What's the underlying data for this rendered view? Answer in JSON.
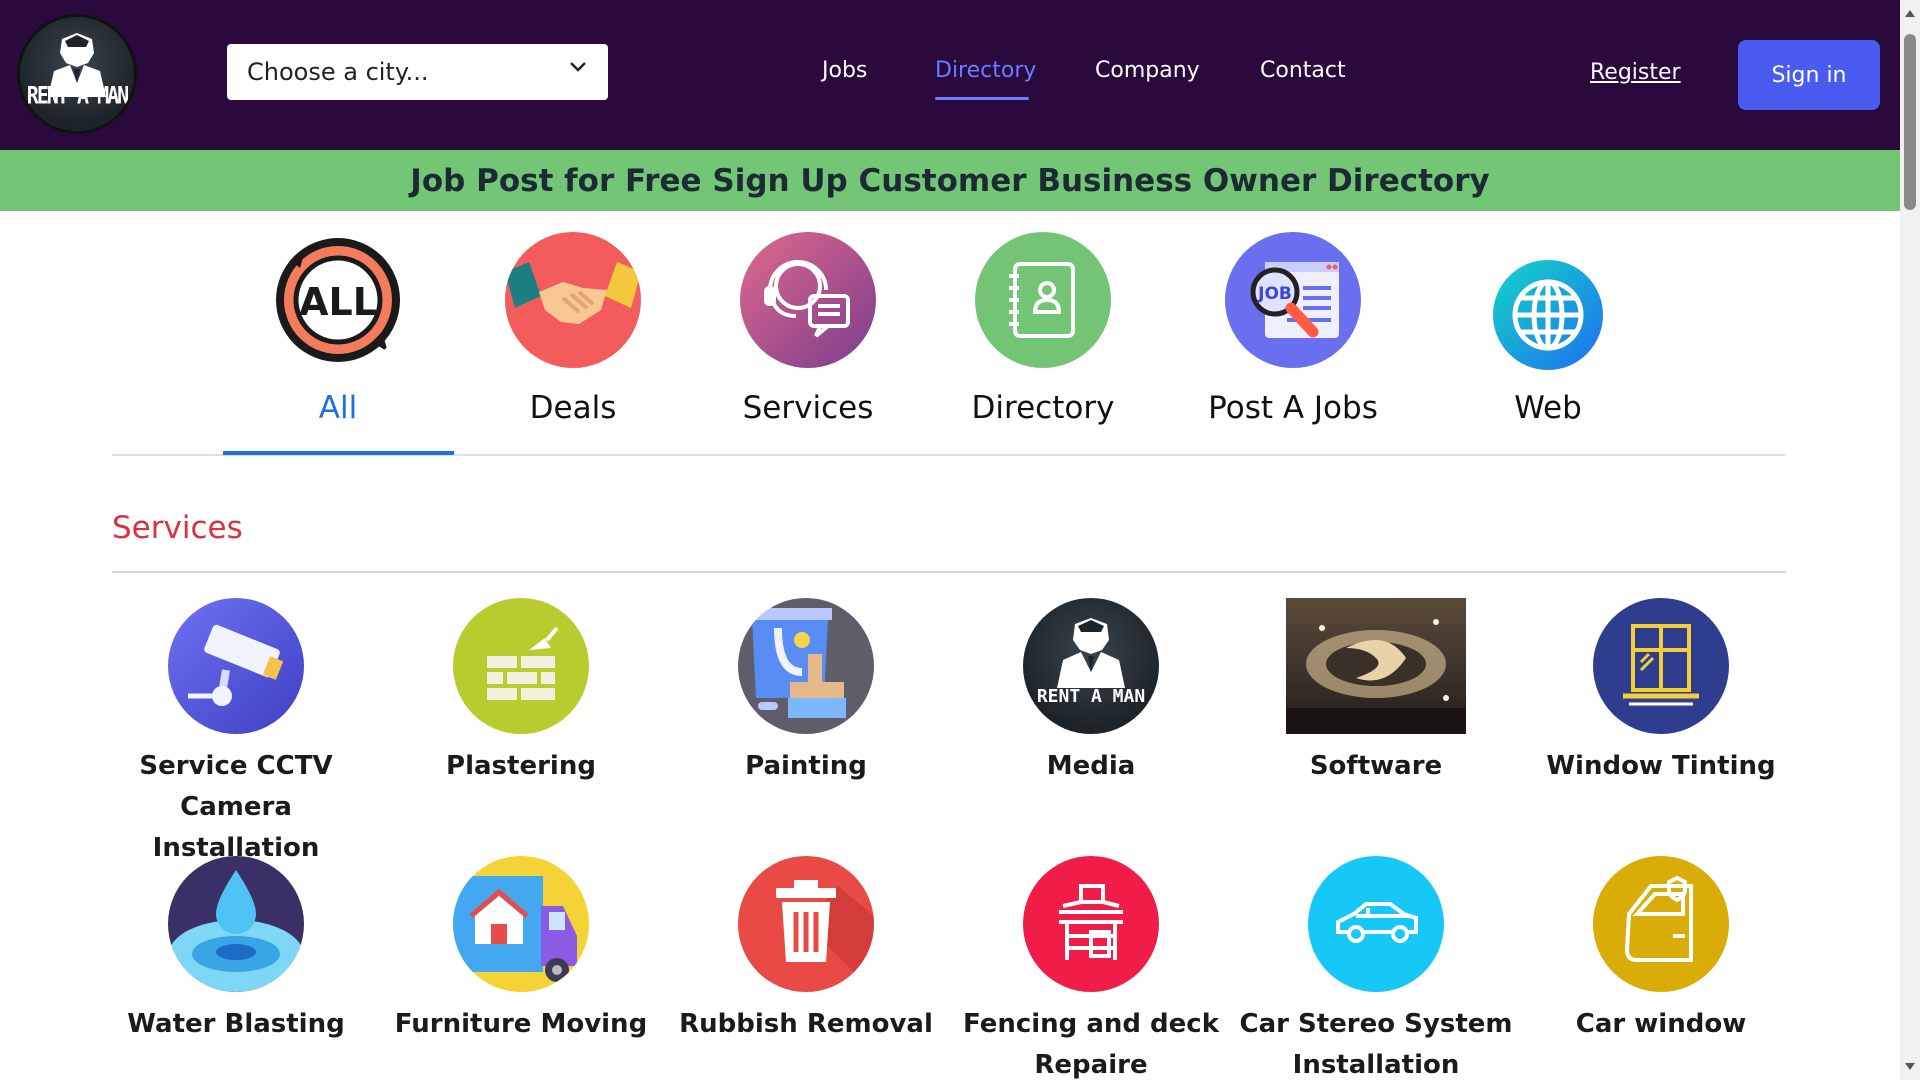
{
  "header": {
    "logo_text": "RENT A MAN",
    "city_placeholder": "Choose a city...",
    "nav": [
      {
        "label": "Jobs",
        "active": false
      },
      {
        "label": "Directory",
        "active": true
      },
      {
        "label": "Company",
        "active": false
      },
      {
        "label": "Contact",
        "active": false
      }
    ],
    "register": "Register",
    "signin": "Sign in"
  },
  "banner": "Job Post for Free Sign Up Customer Business Owner Directory",
  "categories": [
    {
      "label": "All",
      "icon": "all-icon",
      "active": true
    },
    {
      "label": "Deals",
      "icon": "handshake-icon",
      "active": false
    },
    {
      "label": "Services",
      "icon": "headset-support-icon",
      "active": false
    },
    {
      "label": "Directory",
      "icon": "address-book-icon",
      "active": false
    },
    {
      "label": "Post A Jobs",
      "icon": "job-search-icon",
      "active": false
    },
    {
      "label": "Web",
      "icon": "globe-icon",
      "active": false
    }
  ],
  "section_title": "Services",
  "services": [
    {
      "label": "Service CCTV Camera Installation",
      "icon": "cctv-camera-icon"
    },
    {
      "label": "Plastering",
      "icon": "brick-wall-icon"
    },
    {
      "label": "Painting",
      "icon": "paint-bucket-icon"
    },
    {
      "label": "Media",
      "icon": "rent-a-man-logo-icon"
    },
    {
      "label": "Software",
      "icon": "ceiling-photo-icon"
    },
    {
      "label": "Window Tinting",
      "icon": "window-icon"
    },
    {
      "label": "Water Blasting",
      "icon": "water-drop-icon"
    },
    {
      "label": "Furniture Moving",
      "icon": "moving-truck-icon"
    },
    {
      "label": "Rubbish Removal",
      "icon": "trash-bin-icon"
    },
    {
      "label": "Fencing and deck Repaire",
      "icon": "fence-deck-icon"
    },
    {
      "label": "Car Stereo System Installation",
      "icon": "car-icon"
    },
    {
      "label": "Car window",
      "icon": "car-door-icon"
    }
  ],
  "colors": {
    "header_bg": "#2a0a3d",
    "banner_bg": "#72c675",
    "accent_blue": "#1e6fe0",
    "nav_active": "#6a7cff",
    "section_title": "#d9333f",
    "signin_bg": "#4a5cf0"
  }
}
